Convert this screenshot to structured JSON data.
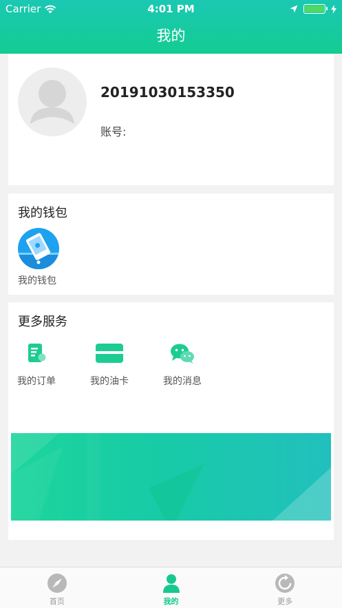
{
  "status": {
    "carrier": "Carrier",
    "time": "4:01 PM"
  },
  "header": {
    "title": "我的"
  },
  "profile": {
    "username": "20191030153350",
    "account_label": "账号:"
  },
  "wallet": {
    "section_title": "我的钱包",
    "item_label": "我的钱包"
  },
  "services": {
    "section_title": "更多服务",
    "items": [
      {
        "label": "我的订单",
        "icon": "order-icon"
      },
      {
        "label": "我的油卡",
        "icon": "card-icon"
      },
      {
        "label": "我的消息",
        "icon": "message-icon"
      }
    ]
  },
  "tabs": [
    {
      "label": "首页",
      "icon": "compass-icon"
    },
    {
      "label": "我的",
      "icon": "user-icon",
      "active": true
    },
    {
      "label": "更多",
      "icon": "refresh-icon"
    }
  ],
  "colors": {
    "accent": "#17c98f",
    "header_top": "#1bc8b3",
    "wallet_blue": "#1ea2ef"
  }
}
